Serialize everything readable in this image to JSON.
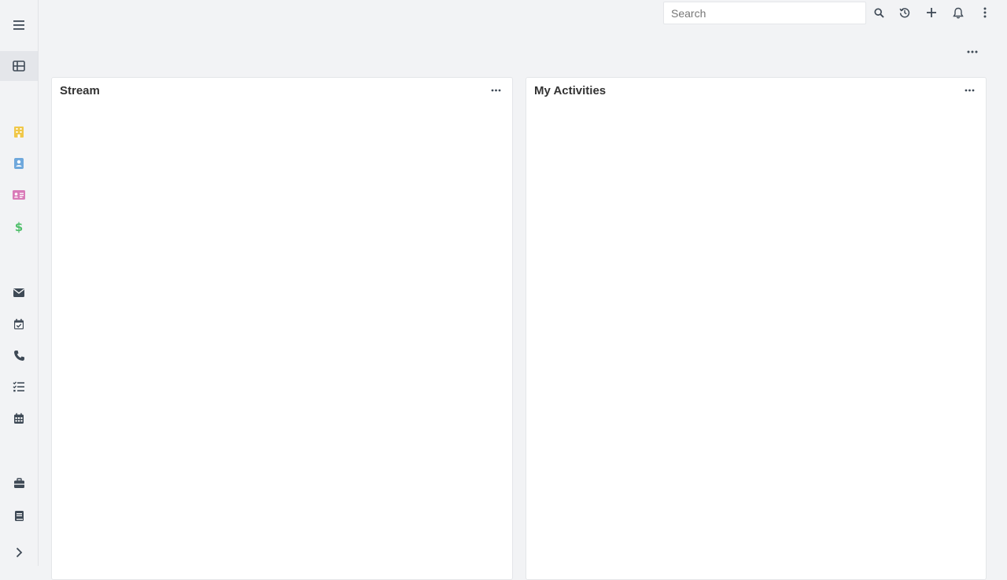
{
  "search": {
    "placeholder": "Search"
  },
  "dashlets": [
    {
      "title": "Stream"
    },
    {
      "title": "My Activities"
    }
  ],
  "sidebar": {
    "items": [
      {
        "icon": "menu-icon"
      },
      {
        "icon": "dashboard-icon"
      },
      {
        "icon": "building-icon",
        "color": "#f0c84a"
      },
      {
        "icon": "contact-badge-icon",
        "color": "#6fa8dc"
      },
      {
        "icon": "id-card-icon",
        "color": "#d97bb8"
      },
      {
        "icon": "dollar-icon",
        "color": "#4fbf6a"
      },
      {
        "icon": "envelope-icon"
      },
      {
        "icon": "calendar-check-icon"
      },
      {
        "icon": "phone-icon"
      },
      {
        "icon": "tasks-icon"
      },
      {
        "icon": "calendar-icon"
      },
      {
        "icon": "briefcase-icon"
      },
      {
        "icon": "book-icon"
      },
      {
        "icon": "chevron-right-icon"
      }
    ]
  },
  "topbar": {
    "icons": [
      "search-icon",
      "history-icon",
      "plus-icon",
      "bell-icon",
      "more-vertical-icon"
    ]
  },
  "colors": {
    "icon": "#3f4a56",
    "background": "#f2f3f5",
    "panel": "#ffffff"
  }
}
